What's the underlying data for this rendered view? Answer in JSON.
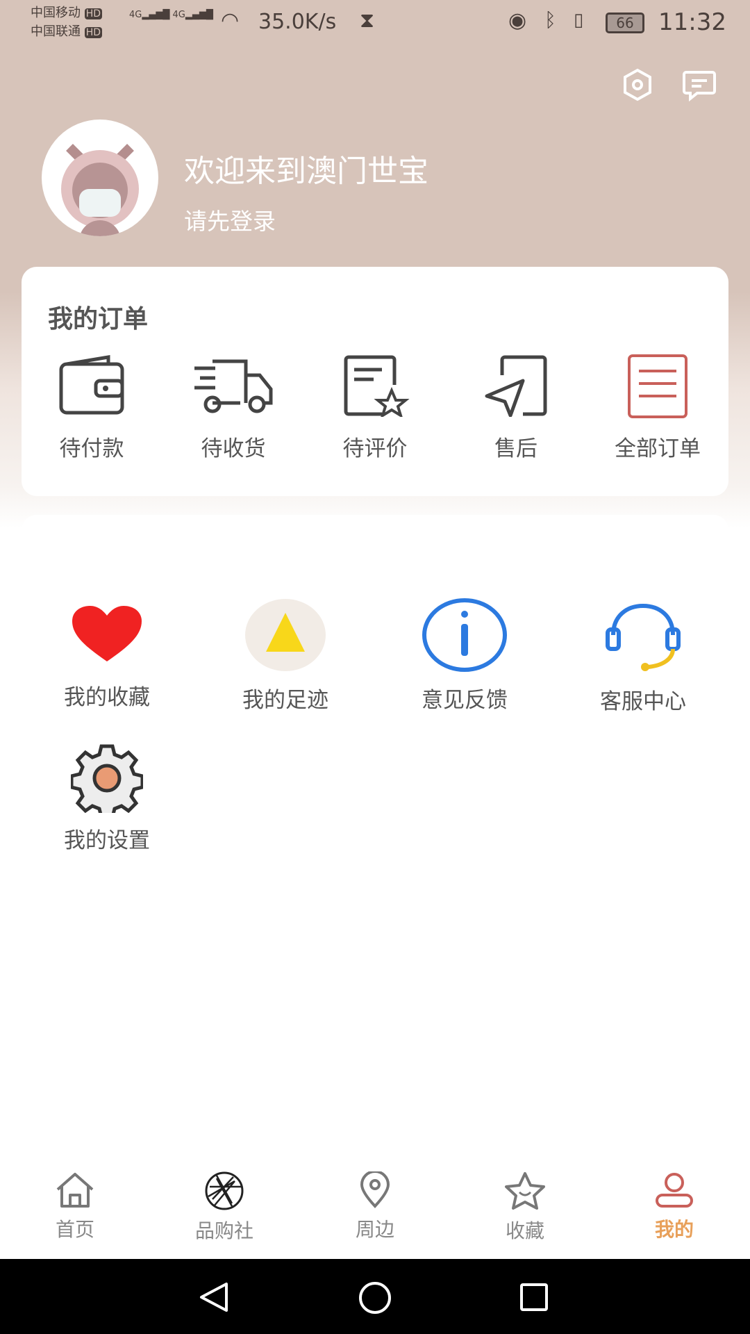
{
  "status_bar": {
    "carrier1": "中国移动",
    "carrier2": "中国联通",
    "hd": "HD",
    "net": "4G",
    "speed": "35.0K/s",
    "battery": "66",
    "time": "11:32"
  },
  "header": {
    "title": "欢迎来到澳门世宝",
    "subtitle": "请先登录"
  },
  "orders": {
    "title": "我的订单",
    "items": [
      {
        "label": "待付款",
        "icon": "wallet-icon"
      },
      {
        "label": "待收货",
        "icon": "truck-icon"
      },
      {
        "label": "待评价",
        "icon": "review-icon"
      },
      {
        "label": "售后",
        "icon": "after-sale-icon"
      },
      {
        "label": "全部订单",
        "icon": "order-list-icon"
      }
    ]
  },
  "services": [
    {
      "label": "我的收藏",
      "icon": "heart-icon"
    },
    {
      "label": "我的足迹",
      "icon": "footprint-icon"
    },
    {
      "label": "意见反馈",
      "icon": "info-icon"
    },
    {
      "label": "客服中心",
      "icon": "headset-icon"
    },
    {
      "label": "我的设置",
      "icon": "gear-icon"
    }
  ],
  "tabs": [
    {
      "label": "首页",
      "icon": "home-icon"
    },
    {
      "label": "品购社",
      "icon": "aperture-icon"
    },
    {
      "label": "周边",
      "icon": "location-icon"
    },
    {
      "label": "收藏",
      "icon": "star-icon"
    },
    {
      "label": "我的",
      "icon": "user-icon",
      "active": true
    }
  ],
  "colors": {
    "active_tab": "#e8a05a",
    "header_bg": "#d7c4ba",
    "order_all": "#c9605a"
  }
}
